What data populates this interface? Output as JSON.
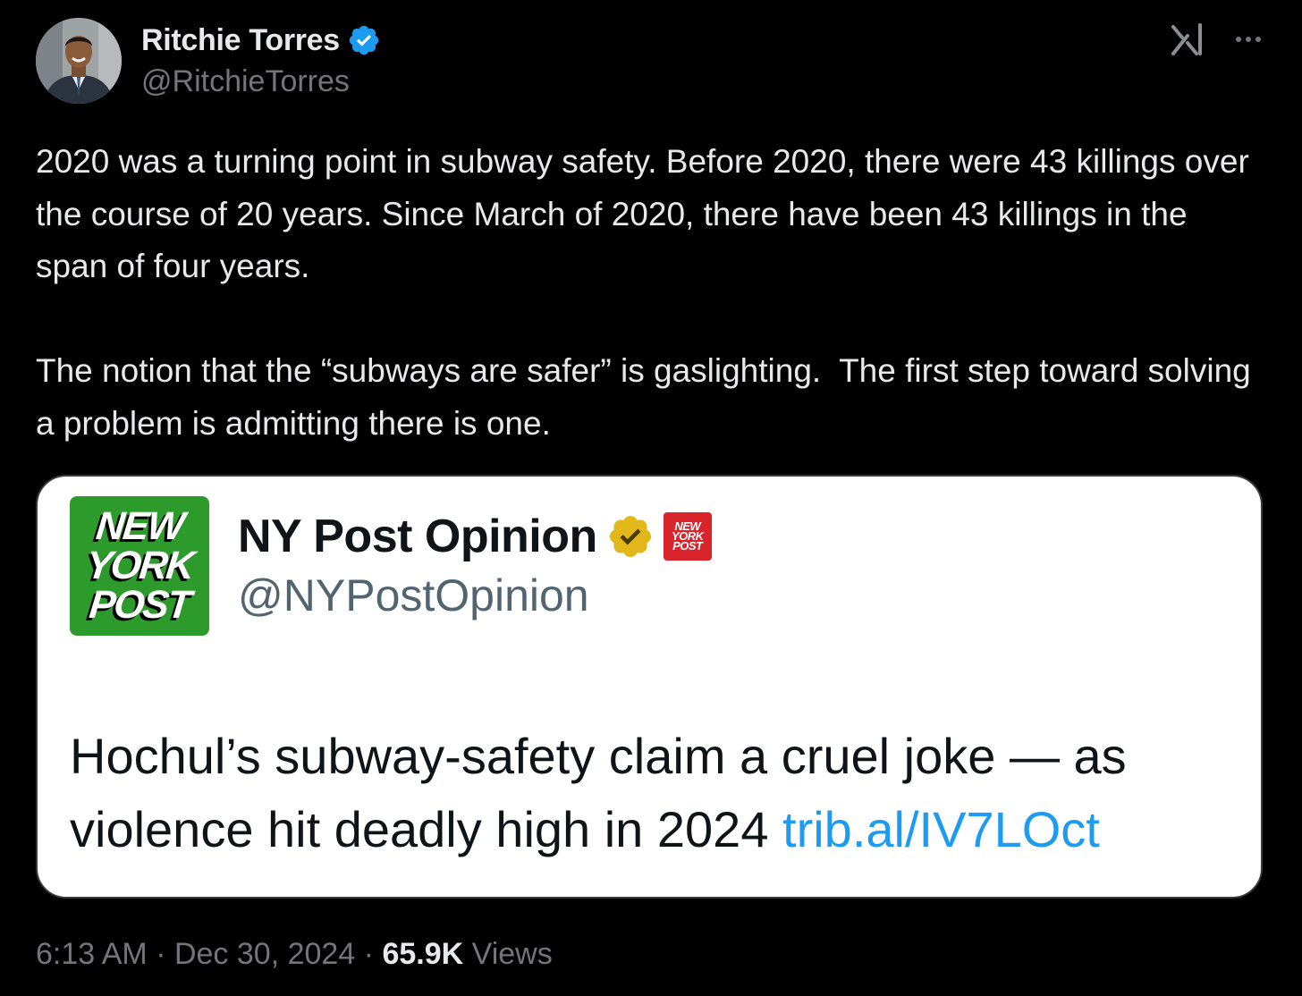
{
  "author": {
    "name": "Ritchie Torres",
    "handle": "@RitchieTorres",
    "verified_badge_color": "#1d9bf0"
  },
  "icons": {
    "avatar": "profile-photo",
    "verified": "verified-badge-icon",
    "app_logo": "grok-logo-icon",
    "more": "more-options-icon"
  },
  "tweet": {
    "text": "2020 was a turning point in subway safety. Before 2020, there were 43 killings over the course of 20 years. Since March of 2020, there have been 43 killings in the span of four years.\n\nThe notion that the “subways are safer” is gaslighting.  The first step toward solving a problem is admitting there is one."
  },
  "quote": {
    "logo_lines": [
      "NEW",
      "YORK",
      "POST"
    ],
    "name": "NY Post Opinion",
    "handle": "@NYPostOpinion",
    "badge_color": "#e2b719",
    "affiliate_logo_lines": [
      "NEW",
      "YORK",
      "POST"
    ],
    "text": "Hochul’s subway-safety claim a cruel joke — as violence hit deadly high in 2024",
    "link": "trib.al/IV7LOct",
    "link_color": "#1d9bf0"
  },
  "meta": {
    "time": "6:13 AM",
    "separator": " · ",
    "date": "Dec 30, 2024",
    "views_count": "65.9K",
    "views_label": " Views"
  }
}
